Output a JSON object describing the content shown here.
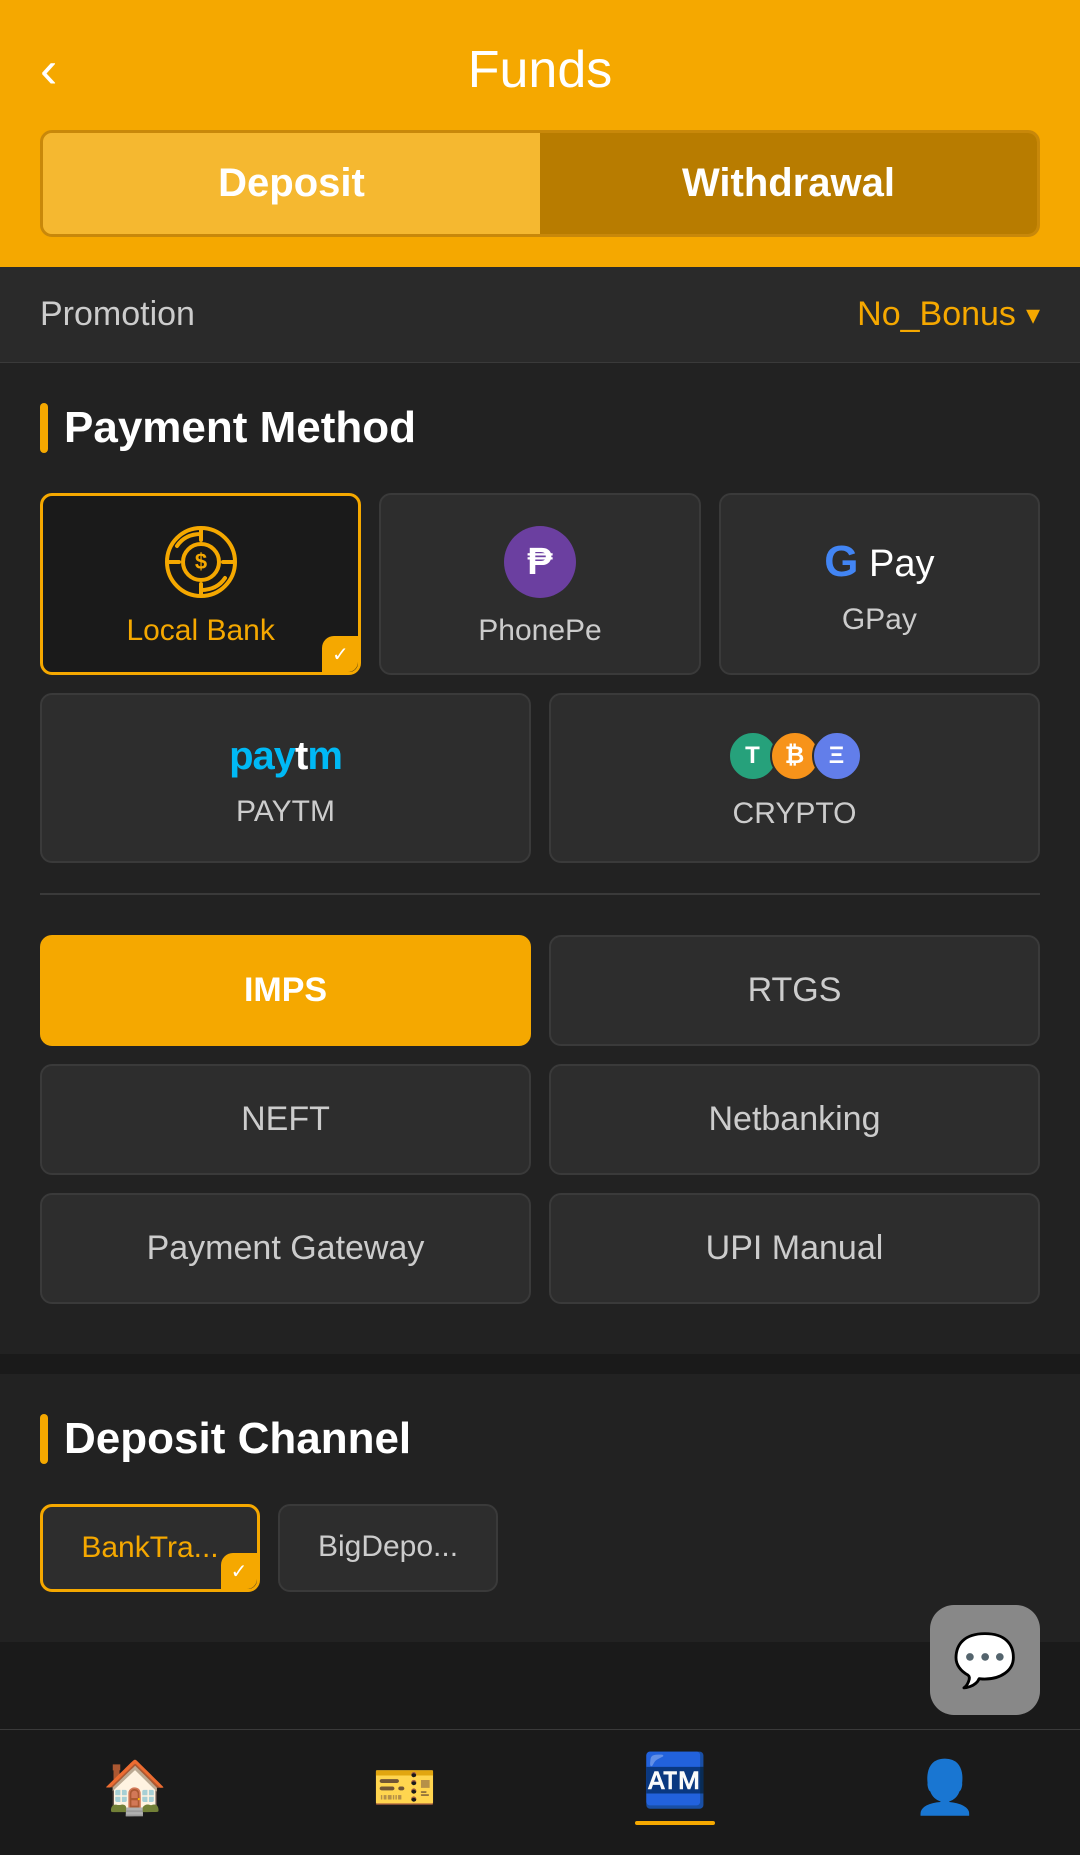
{
  "header": {
    "back_label": "‹",
    "title": "Funds",
    "tab_deposit": "Deposit",
    "tab_withdrawal": "Withdrawal"
  },
  "promo": {
    "label": "Promotion",
    "value": "No_Bonus"
  },
  "payment_method": {
    "section_title": "Payment Method",
    "methods": [
      {
        "id": "local_bank",
        "label": "Local Bank",
        "selected": true
      },
      {
        "id": "phonepe",
        "label": "PhonePe",
        "selected": false
      },
      {
        "id": "gpay",
        "label": "GPay",
        "selected": false
      },
      {
        "id": "paytm",
        "label": "PAYTM",
        "selected": false
      },
      {
        "id": "crypto",
        "label": "CRYPTO",
        "selected": false
      }
    ],
    "sub_methods": [
      {
        "id": "imps",
        "label": "IMPS",
        "active": true
      },
      {
        "id": "rtgs",
        "label": "RTGS",
        "active": false
      },
      {
        "id": "neft",
        "label": "NEFT",
        "active": false
      },
      {
        "id": "netbanking",
        "label": "Netbanking",
        "active": false
      },
      {
        "id": "payment_gateway",
        "label": "Payment Gateway",
        "active": false
      },
      {
        "id": "upi_manual",
        "label": "UPI Manual",
        "active": false
      }
    ]
  },
  "deposit_channel": {
    "section_title": "Deposit Channel",
    "channels": [
      {
        "id": "banktra",
        "label": "BankTra...",
        "selected": true
      },
      {
        "id": "bigdepo",
        "label": "BigDepo...",
        "selected": false
      }
    ]
  },
  "bottom_nav": {
    "items": [
      {
        "id": "home",
        "icon": "🏠",
        "active": false
      },
      {
        "id": "tickets",
        "icon": "🎫",
        "active": false
      },
      {
        "id": "deposit",
        "icon": "🏧",
        "active": true
      },
      {
        "id": "profile",
        "icon": "👤",
        "active": false
      }
    ]
  },
  "chat": {
    "icon": "💬"
  }
}
